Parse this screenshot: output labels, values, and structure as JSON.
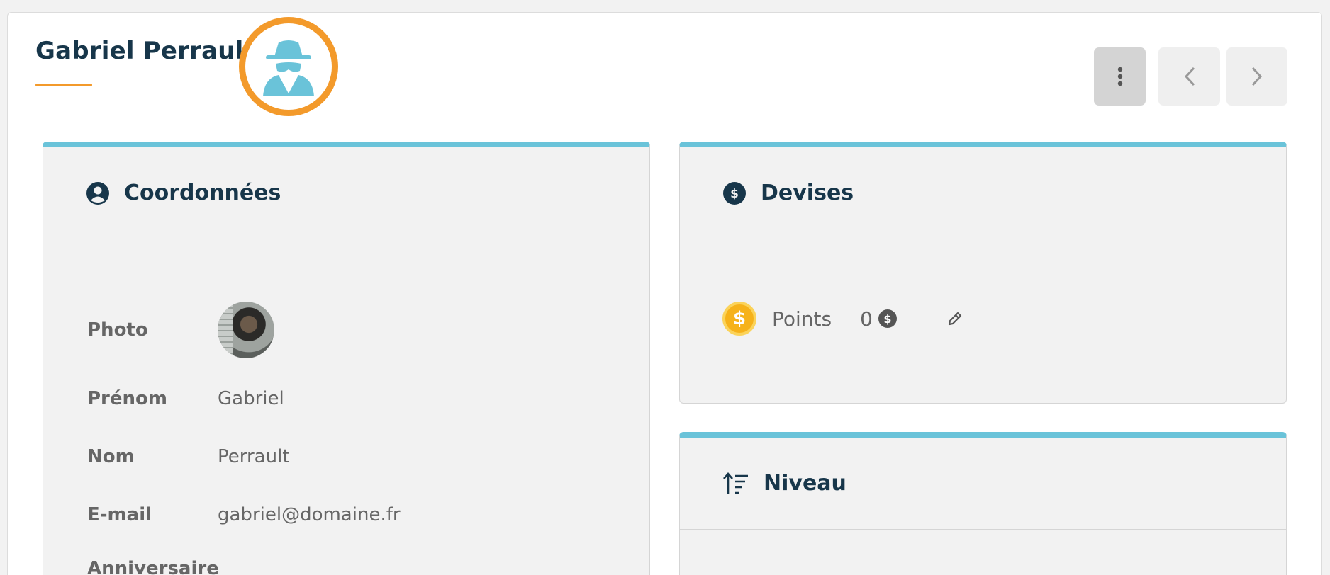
{
  "header": {
    "title": "Gabriel Perrault",
    "badge_icon": "spy-icon",
    "accent_color": "#f39a2b"
  },
  "toolbar": {
    "more_icon": "vertical-dots-icon",
    "prev_icon": "chevron-left-icon",
    "next_icon": "chevron-right-icon"
  },
  "panels": {
    "coordonnees": {
      "title": "Coordonnées",
      "icon": "user-circle-icon",
      "fields": [
        {
          "label": "Photo",
          "value": ""
        },
        {
          "label": "Prénom",
          "value": "Gabriel"
        },
        {
          "label": "Nom",
          "value": "Perrault"
        },
        {
          "label": "E-mail",
          "value": "gabriel@domaine.fr"
        },
        {
          "label": "Anniversaire",
          "value": ""
        }
      ]
    },
    "devises": {
      "title": "Devises",
      "icon": "dollar-circle-icon",
      "points_label": "Points",
      "points_value": "0",
      "coin_symbol": "$",
      "edit_icon": "pencil-icon"
    },
    "niveau": {
      "title": "Niveau",
      "icon": "sort-ascending-icon"
    }
  },
  "colors": {
    "panel_accent": "#6ac3d9",
    "title_text": "#17364a",
    "coin": "#f6b21a"
  }
}
